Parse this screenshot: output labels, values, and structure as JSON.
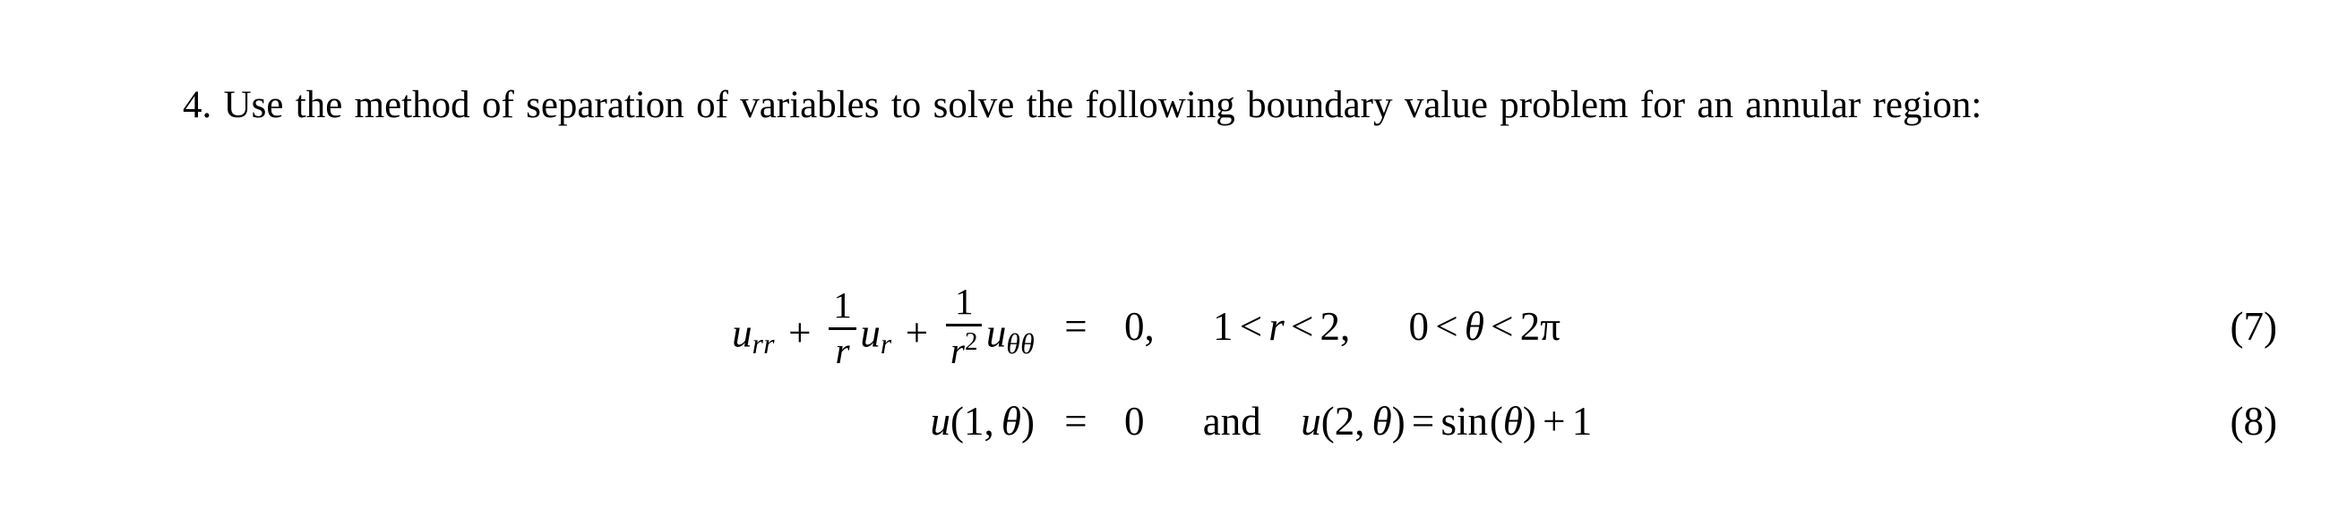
{
  "document": {
    "background_color": "#ffffff",
    "text_color": "#000000",
    "problem": {
      "number_label": "4.",
      "body": "4. Use the method of separation of variables to solve the following boundary value problem for an annular region:"
    },
    "equations": [
      {
        "tag": "(7)",
        "lhs": {
          "term1_base": "u",
          "term1_sub": "rr",
          "plus1": "+",
          "frac1_num": "1",
          "frac1_den": "r",
          "term2_base": "u",
          "term2_sub": "r",
          "plus2": "+",
          "frac2_num": "1",
          "frac2_den_base": "r",
          "frac2_den_exp": "2",
          "term3_base": "u",
          "term3_sub": "θθ"
        },
        "relation": "=",
        "rhs": {
          "value": "0,",
          "domain_r_lower": "1",
          "domain_r_lt1": "<",
          "domain_r_var": "r",
          "domain_r_lt2": "<",
          "domain_r_upper": "2,",
          "domain_t_lower": "0",
          "domain_t_lt1": "<",
          "domain_t_var": "θ",
          "domain_t_lt2": "<",
          "domain_t_upper": "2π"
        }
      },
      {
        "tag": "(8)",
        "lhs": {
          "func": "u",
          "open": "(",
          "arg1": "1",
          "comma": ",",
          "arg2": "θ",
          "close": ")"
        },
        "relation": "=",
        "rhs": {
          "value": "0",
          "conjunction": "and",
          "func2": "u",
          "open2": "(",
          "arg1b": "2",
          "comma2": ",",
          "arg2b": "θ",
          "close2": ")",
          "equals2": "=",
          "sinfunc": "sin",
          "open3": "(",
          "sinarg": "θ",
          "close3": ")",
          "plus": "+",
          "const": "1"
        }
      }
    ]
  }
}
